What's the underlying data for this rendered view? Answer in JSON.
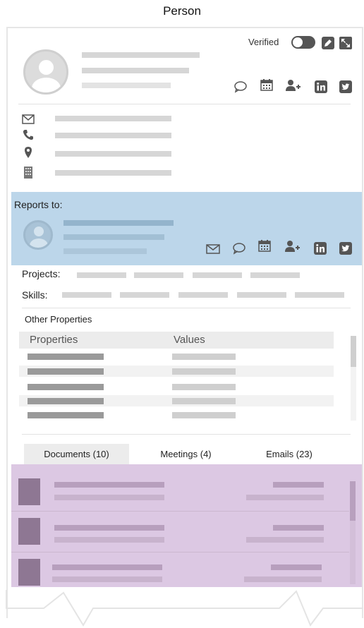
{
  "page": {
    "title": "Person"
  },
  "header": {
    "verified_label": "Verified",
    "verified_on": true,
    "action_icons": [
      "edit-icon",
      "expand-icon"
    ],
    "contact_icons": [
      "chat-icon",
      "calendar-icon",
      "add-user-icon",
      "linkedin-icon",
      "twitter-icon"
    ]
  },
  "contact_rows": [
    "email-icon",
    "phone-icon",
    "location-icon",
    "building-icon"
  ],
  "reports_to": {
    "label": "Reports to:",
    "icons": [
      "email-icon",
      "chat-icon",
      "calendar-icon",
      "add-user-icon",
      "linkedin-icon",
      "twitter-icon"
    ]
  },
  "projects": {
    "label": "Projects:"
  },
  "skills": {
    "label": "Skills:"
  },
  "other_properties": {
    "title": "Other Properties",
    "columns": [
      "Properties",
      "Values"
    ]
  },
  "tabs": [
    {
      "label": "Documents (10)",
      "active": true
    },
    {
      "label": "Meetings (4)",
      "active": false
    },
    {
      "label": "Emails (23)",
      "active": false
    }
  ],
  "colors": {
    "reports_bg": "#bcd6ea",
    "documents_bg": "#dcc8e3",
    "document_thumb": "#8e7793"
  }
}
